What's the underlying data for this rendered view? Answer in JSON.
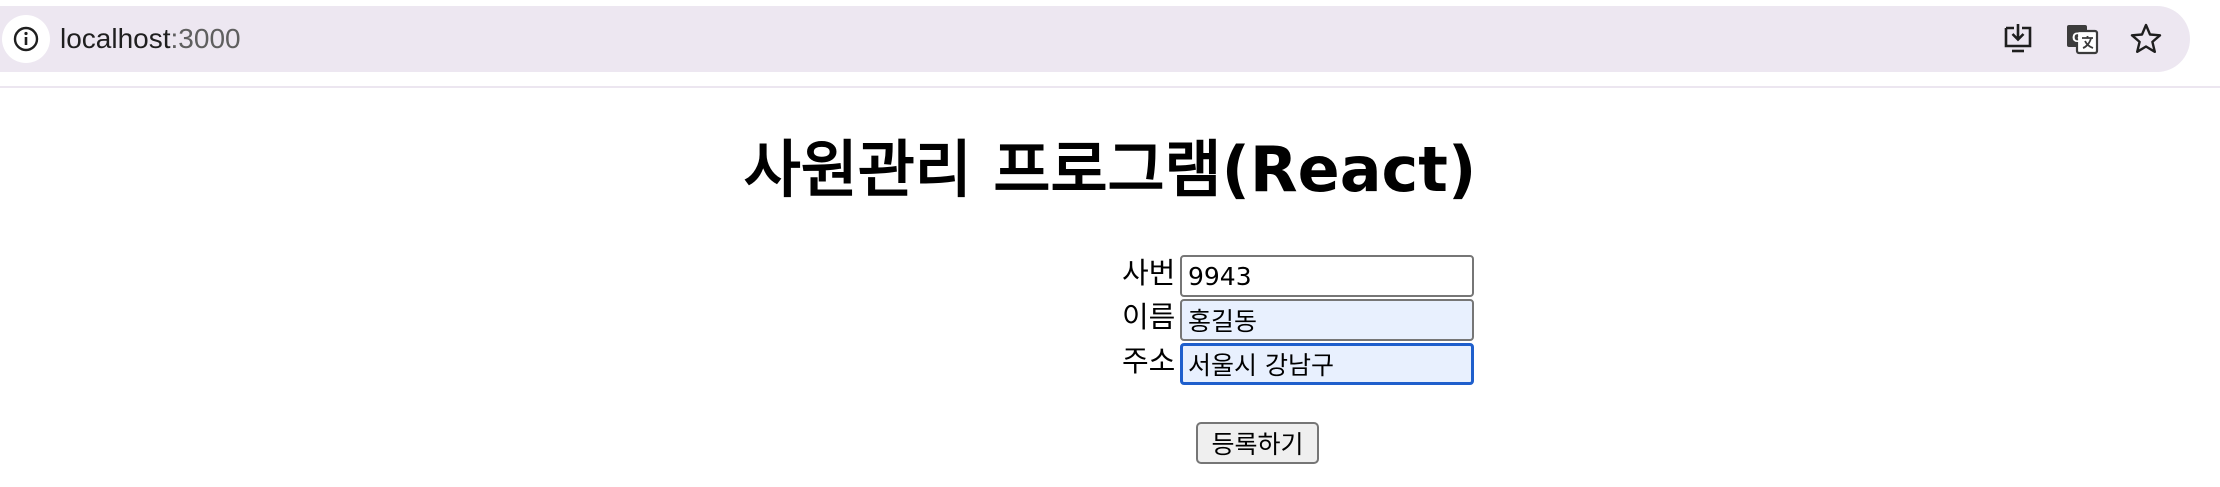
{
  "browser": {
    "url_host": "localhost",
    "url_port": ":3000",
    "icons": [
      "site-info-icon",
      "install-app-icon",
      "translate-icon",
      "bookmark-star-icon"
    ]
  },
  "page": {
    "title": "사원관리 프로그램(React)",
    "form": {
      "fields": [
        {
          "label": "사번",
          "value": "9943"
        },
        {
          "label": "이름",
          "value": "홍길동"
        },
        {
          "label": "주소",
          "value": "서울시 강남구"
        }
      ],
      "submit_label": "등록하기"
    }
  },
  "colors": {
    "toolbar_bg": "#ede7f1",
    "autofill_bg": "#e8f0fe",
    "focus_border": "#1f5fcc"
  }
}
